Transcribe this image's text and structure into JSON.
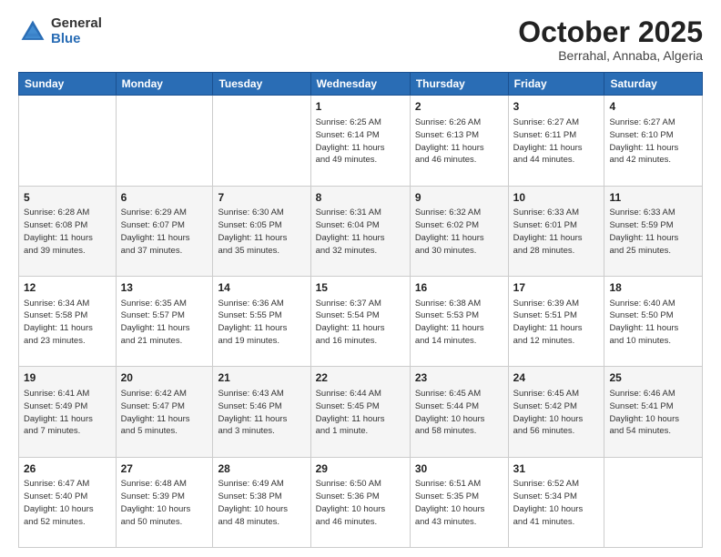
{
  "logo": {
    "general": "General",
    "blue": "Blue"
  },
  "title": "October 2025",
  "subtitle": "Berrahal, Annaba, Algeria",
  "weekdays": [
    "Sunday",
    "Monday",
    "Tuesday",
    "Wednesday",
    "Thursday",
    "Friday",
    "Saturday"
  ],
  "weeks": [
    [
      {
        "day": "",
        "info": ""
      },
      {
        "day": "",
        "info": ""
      },
      {
        "day": "",
        "info": ""
      },
      {
        "day": "1",
        "info": "Sunrise: 6:25 AM\nSunset: 6:14 PM\nDaylight: 11 hours\nand 49 minutes."
      },
      {
        "day": "2",
        "info": "Sunrise: 6:26 AM\nSunset: 6:13 PM\nDaylight: 11 hours\nand 46 minutes."
      },
      {
        "day": "3",
        "info": "Sunrise: 6:27 AM\nSunset: 6:11 PM\nDaylight: 11 hours\nand 44 minutes."
      },
      {
        "day": "4",
        "info": "Sunrise: 6:27 AM\nSunset: 6:10 PM\nDaylight: 11 hours\nand 42 minutes."
      }
    ],
    [
      {
        "day": "5",
        "info": "Sunrise: 6:28 AM\nSunset: 6:08 PM\nDaylight: 11 hours\nand 39 minutes."
      },
      {
        "day": "6",
        "info": "Sunrise: 6:29 AM\nSunset: 6:07 PM\nDaylight: 11 hours\nand 37 minutes."
      },
      {
        "day": "7",
        "info": "Sunrise: 6:30 AM\nSunset: 6:05 PM\nDaylight: 11 hours\nand 35 minutes."
      },
      {
        "day": "8",
        "info": "Sunrise: 6:31 AM\nSunset: 6:04 PM\nDaylight: 11 hours\nand 32 minutes."
      },
      {
        "day": "9",
        "info": "Sunrise: 6:32 AM\nSunset: 6:02 PM\nDaylight: 11 hours\nand 30 minutes."
      },
      {
        "day": "10",
        "info": "Sunrise: 6:33 AM\nSunset: 6:01 PM\nDaylight: 11 hours\nand 28 minutes."
      },
      {
        "day": "11",
        "info": "Sunrise: 6:33 AM\nSunset: 5:59 PM\nDaylight: 11 hours\nand 25 minutes."
      }
    ],
    [
      {
        "day": "12",
        "info": "Sunrise: 6:34 AM\nSunset: 5:58 PM\nDaylight: 11 hours\nand 23 minutes."
      },
      {
        "day": "13",
        "info": "Sunrise: 6:35 AM\nSunset: 5:57 PM\nDaylight: 11 hours\nand 21 minutes."
      },
      {
        "day": "14",
        "info": "Sunrise: 6:36 AM\nSunset: 5:55 PM\nDaylight: 11 hours\nand 19 minutes."
      },
      {
        "day": "15",
        "info": "Sunrise: 6:37 AM\nSunset: 5:54 PM\nDaylight: 11 hours\nand 16 minutes."
      },
      {
        "day": "16",
        "info": "Sunrise: 6:38 AM\nSunset: 5:53 PM\nDaylight: 11 hours\nand 14 minutes."
      },
      {
        "day": "17",
        "info": "Sunrise: 6:39 AM\nSunset: 5:51 PM\nDaylight: 11 hours\nand 12 minutes."
      },
      {
        "day": "18",
        "info": "Sunrise: 6:40 AM\nSunset: 5:50 PM\nDaylight: 11 hours\nand 10 minutes."
      }
    ],
    [
      {
        "day": "19",
        "info": "Sunrise: 6:41 AM\nSunset: 5:49 PM\nDaylight: 11 hours\nand 7 minutes."
      },
      {
        "day": "20",
        "info": "Sunrise: 6:42 AM\nSunset: 5:47 PM\nDaylight: 11 hours\nand 5 minutes."
      },
      {
        "day": "21",
        "info": "Sunrise: 6:43 AM\nSunset: 5:46 PM\nDaylight: 11 hours\nand 3 minutes."
      },
      {
        "day": "22",
        "info": "Sunrise: 6:44 AM\nSunset: 5:45 PM\nDaylight: 11 hours\nand 1 minute."
      },
      {
        "day": "23",
        "info": "Sunrise: 6:45 AM\nSunset: 5:44 PM\nDaylight: 10 hours\nand 58 minutes."
      },
      {
        "day": "24",
        "info": "Sunrise: 6:45 AM\nSunset: 5:42 PM\nDaylight: 10 hours\nand 56 minutes."
      },
      {
        "day": "25",
        "info": "Sunrise: 6:46 AM\nSunset: 5:41 PM\nDaylight: 10 hours\nand 54 minutes."
      }
    ],
    [
      {
        "day": "26",
        "info": "Sunrise: 6:47 AM\nSunset: 5:40 PM\nDaylight: 10 hours\nand 52 minutes."
      },
      {
        "day": "27",
        "info": "Sunrise: 6:48 AM\nSunset: 5:39 PM\nDaylight: 10 hours\nand 50 minutes."
      },
      {
        "day": "28",
        "info": "Sunrise: 6:49 AM\nSunset: 5:38 PM\nDaylight: 10 hours\nand 48 minutes."
      },
      {
        "day": "29",
        "info": "Sunrise: 6:50 AM\nSunset: 5:36 PM\nDaylight: 10 hours\nand 46 minutes."
      },
      {
        "day": "30",
        "info": "Sunrise: 6:51 AM\nSunset: 5:35 PM\nDaylight: 10 hours\nand 43 minutes."
      },
      {
        "day": "31",
        "info": "Sunrise: 6:52 AM\nSunset: 5:34 PM\nDaylight: 10 hours\nand 41 minutes."
      },
      {
        "day": "",
        "info": ""
      }
    ]
  ]
}
